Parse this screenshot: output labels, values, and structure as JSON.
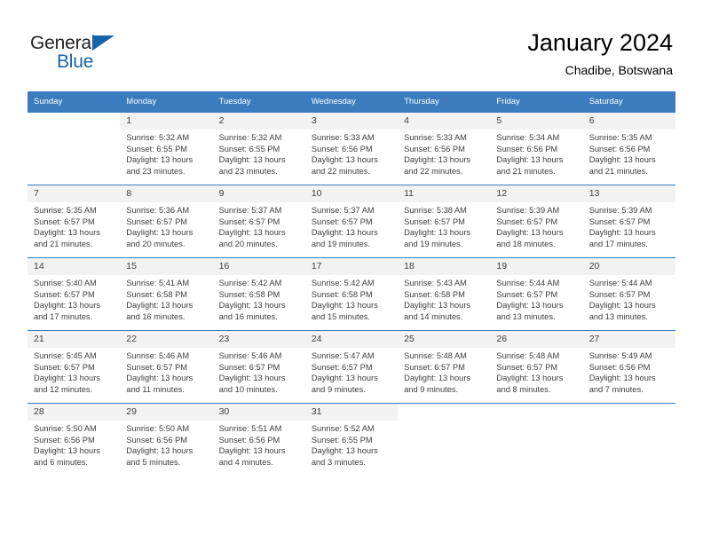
{
  "brand": {
    "name_part1": "General",
    "name_part2": "Blue",
    "accent_color": "#1565a8"
  },
  "header": {
    "title": "January 2024",
    "subtitle": "Chadibe, Botswana",
    "header_bg_color": "#3a7cbe",
    "daynum_bg_color": "#f2f2f2"
  },
  "weekday_headers": [
    "Sunday",
    "Monday",
    "Tuesday",
    "Wednesday",
    "Thursday",
    "Friday",
    "Saturday"
  ],
  "weeks": [
    [
      {
        "day": "",
        "sunrise": "",
        "sunset": "",
        "daylight_line1": "",
        "daylight_line2": "",
        "empty": true
      },
      {
        "day": "1",
        "sunrise": "Sunrise: 5:32 AM",
        "sunset": "Sunset: 6:55 PM",
        "daylight_line1": "Daylight: 13 hours",
        "daylight_line2": "and 23 minutes."
      },
      {
        "day": "2",
        "sunrise": "Sunrise: 5:32 AM",
        "sunset": "Sunset: 6:55 PM",
        "daylight_line1": "Daylight: 13 hours",
        "daylight_line2": "and 23 minutes."
      },
      {
        "day": "3",
        "sunrise": "Sunrise: 5:33 AM",
        "sunset": "Sunset: 6:56 PM",
        "daylight_line1": "Daylight: 13 hours",
        "daylight_line2": "and 22 minutes."
      },
      {
        "day": "4",
        "sunrise": "Sunrise: 5:33 AM",
        "sunset": "Sunset: 6:56 PM",
        "daylight_line1": "Daylight: 13 hours",
        "daylight_line2": "and 22 minutes."
      },
      {
        "day": "5",
        "sunrise": "Sunrise: 5:34 AM",
        "sunset": "Sunset: 6:56 PM",
        "daylight_line1": "Daylight: 13 hours",
        "daylight_line2": "and 21 minutes."
      },
      {
        "day": "6",
        "sunrise": "Sunrise: 5:35 AM",
        "sunset": "Sunset: 6:56 PM",
        "daylight_line1": "Daylight: 13 hours",
        "daylight_line2": "and 21 minutes."
      }
    ],
    [
      {
        "day": "7",
        "sunrise": "Sunrise: 5:35 AM",
        "sunset": "Sunset: 6:57 PM",
        "daylight_line1": "Daylight: 13 hours",
        "daylight_line2": "and 21 minutes."
      },
      {
        "day": "8",
        "sunrise": "Sunrise: 5:36 AM",
        "sunset": "Sunset: 6:57 PM",
        "daylight_line1": "Daylight: 13 hours",
        "daylight_line2": "and 20 minutes."
      },
      {
        "day": "9",
        "sunrise": "Sunrise: 5:37 AM",
        "sunset": "Sunset: 6:57 PM",
        "daylight_line1": "Daylight: 13 hours",
        "daylight_line2": "and 20 minutes."
      },
      {
        "day": "10",
        "sunrise": "Sunrise: 5:37 AM",
        "sunset": "Sunset: 6:57 PM",
        "daylight_line1": "Daylight: 13 hours",
        "daylight_line2": "and 19 minutes."
      },
      {
        "day": "11",
        "sunrise": "Sunrise: 5:38 AM",
        "sunset": "Sunset: 6:57 PM",
        "daylight_line1": "Daylight: 13 hours",
        "daylight_line2": "and 19 minutes."
      },
      {
        "day": "12",
        "sunrise": "Sunrise: 5:39 AM",
        "sunset": "Sunset: 6:57 PM",
        "daylight_line1": "Daylight: 13 hours",
        "daylight_line2": "and 18 minutes."
      },
      {
        "day": "13",
        "sunrise": "Sunrise: 5:39 AM",
        "sunset": "Sunset: 6:57 PM",
        "daylight_line1": "Daylight: 13 hours",
        "daylight_line2": "and 17 minutes."
      }
    ],
    [
      {
        "day": "14",
        "sunrise": "Sunrise: 5:40 AM",
        "sunset": "Sunset: 6:57 PM",
        "daylight_line1": "Daylight: 13 hours",
        "daylight_line2": "and 17 minutes."
      },
      {
        "day": "15",
        "sunrise": "Sunrise: 5:41 AM",
        "sunset": "Sunset: 6:58 PM",
        "daylight_line1": "Daylight: 13 hours",
        "daylight_line2": "and 16 minutes."
      },
      {
        "day": "16",
        "sunrise": "Sunrise: 5:42 AM",
        "sunset": "Sunset: 6:58 PM",
        "daylight_line1": "Daylight: 13 hours",
        "daylight_line2": "and 16 minutes."
      },
      {
        "day": "17",
        "sunrise": "Sunrise: 5:42 AM",
        "sunset": "Sunset: 6:58 PM",
        "daylight_line1": "Daylight: 13 hours",
        "daylight_line2": "and 15 minutes."
      },
      {
        "day": "18",
        "sunrise": "Sunrise: 5:43 AM",
        "sunset": "Sunset: 6:58 PM",
        "daylight_line1": "Daylight: 13 hours",
        "daylight_line2": "and 14 minutes."
      },
      {
        "day": "19",
        "sunrise": "Sunrise: 5:44 AM",
        "sunset": "Sunset: 6:57 PM",
        "daylight_line1": "Daylight: 13 hours",
        "daylight_line2": "and 13 minutes."
      },
      {
        "day": "20",
        "sunrise": "Sunrise: 5:44 AM",
        "sunset": "Sunset: 6:57 PM",
        "daylight_line1": "Daylight: 13 hours",
        "daylight_line2": "and 13 minutes."
      }
    ],
    [
      {
        "day": "21",
        "sunrise": "Sunrise: 5:45 AM",
        "sunset": "Sunset: 6:57 PM",
        "daylight_line1": "Daylight: 13 hours",
        "daylight_line2": "and 12 minutes."
      },
      {
        "day": "22",
        "sunrise": "Sunrise: 5:46 AM",
        "sunset": "Sunset: 6:57 PM",
        "daylight_line1": "Daylight: 13 hours",
        "daylight_line2": "and 11 minutes."
      },
      {
        "day": "23",
        "sunrise": "Sunrise: 5:46 AM",
        "sunset": "Sunset: 6:57 PM",
        "daylight_line1": "Daylight: 13 hours",
        "daylight_line2": "and 10 minutes."
      },
      {
        "day": "24",
        "sunrise": "Sunrise: 5:47 AM",
        "sunset": "Sunset: 6:57 PM",
        "daylight_line1": "Daylight: 13 hours",
        "daylight_line2": "and 9 minutes."
      },
      {
        "day": "25",
        "sunrise": "Sunrise: 5:48 AM",
        "sunset": "Sunset: 6:57 PM",
        "daylight_line1": "Daylight: 13 hours",
        "daylight_line2": "and 9 minutes."
      },
      {
        "day": "26",
        "sunrise": "Sunrise: 5:48 AM",
        "sunset": "Sunset: 6:57 PM",
        "daylight_line1": "Daylight: 13 hours",
        "daylight_line2": "and 8 minutes."
      },
      {
        "day": "27",
        "sunrise": "Sunrise: 5:49 AM",
        "sunset": "Sunset: 6:56 PM",
        "daylight_line1": "Daylight: 13 hours",
        "daylight_line2": "and 7 minutes."
      }
    ],
    [
      {
        "day": "28",
        "sunrise": "Sunrise: 5:50 AM",
        "sunset": "Sunset: 6:56 PM",
        "daylight_line1": "Daylight: 13 hours",
        "daylight_line2": "and 6 minutes."
      },
      {
        "day": "29",
        "sunrise": "Sunrise: 5:50 AM",
        "sunset": "Sunset: 6:56 PM",
        "daylight_line1": "Daylight: 13 hours",
        "daylight_line2": "and 5 minutes."
      },
      {
        "day": "30",
        "sunrise": "Sunrise: 5:51 AM",
        "sunset": "Sunset: 6:56 PM",
        "daylight_line1": "Daylight: 13 hours",
        "daylight_line2": "and 4 minutes."
      },
      {
        "day": "31",
        "sunrise": "Sunrise: 5:52 AM",
        "sunset": "Sunset: 6:55 PM",
        "daylight_line1": "Daylight: 13 hours",
        "daylight_line2": "and 3 minutes."
      },
      {
        "day": "",
        "sunrise": "",
        "sunset": "",
        "daylight_line1": "",
        "daylight_line2": "",
        "empty": true
      },
      {
        "day": "",
        "sunrise": "",
        "sunset": "",
        "daylight_line1": "",
        "daylight_line2": "",
        "empty": true
      },
      {
        "day": "",
        "sunrise": "",
        "sunset": "",
        "daylight_line1": "",
        "daylight_line2": "",
        "empty": true
      }
    ]
  ]
}
